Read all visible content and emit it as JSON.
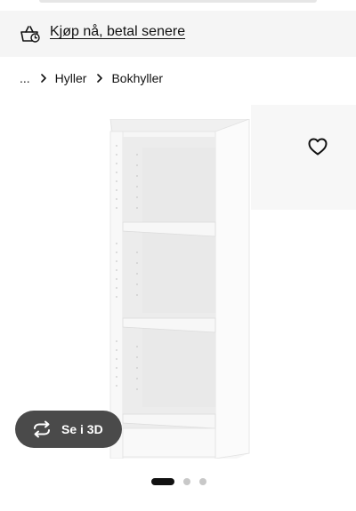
{
  "promo": {
    "link_text": "Kjøp nå, betal senere",
    "icon": "basket-clock-icon"
  },
  "breadcrumb": {
    "items": [
      "...",
      "Hyller",
      "Bokhyller"
    ],
    "separator_icon": "chevron-right-icon"
  },
  "product_image": {
    "subject": "bookshelf-white"
  },
  "favourite": {
    "icon": "heart-outline-icon"
  },
  "view_3d": {
    "label": "Se i 3D",
    "icon": "rotate-arrows-icon"
  },
  "carousel": {
    "total_slides": 3,
    "active_index": 0
  },
  "colors": {
    "promo_background": "#f5f5f5",
    "button_background": "#4a4a4a",
    "dot_active": "#111111",
    "dot_inactive": "#c8c8c8"
  }
}
